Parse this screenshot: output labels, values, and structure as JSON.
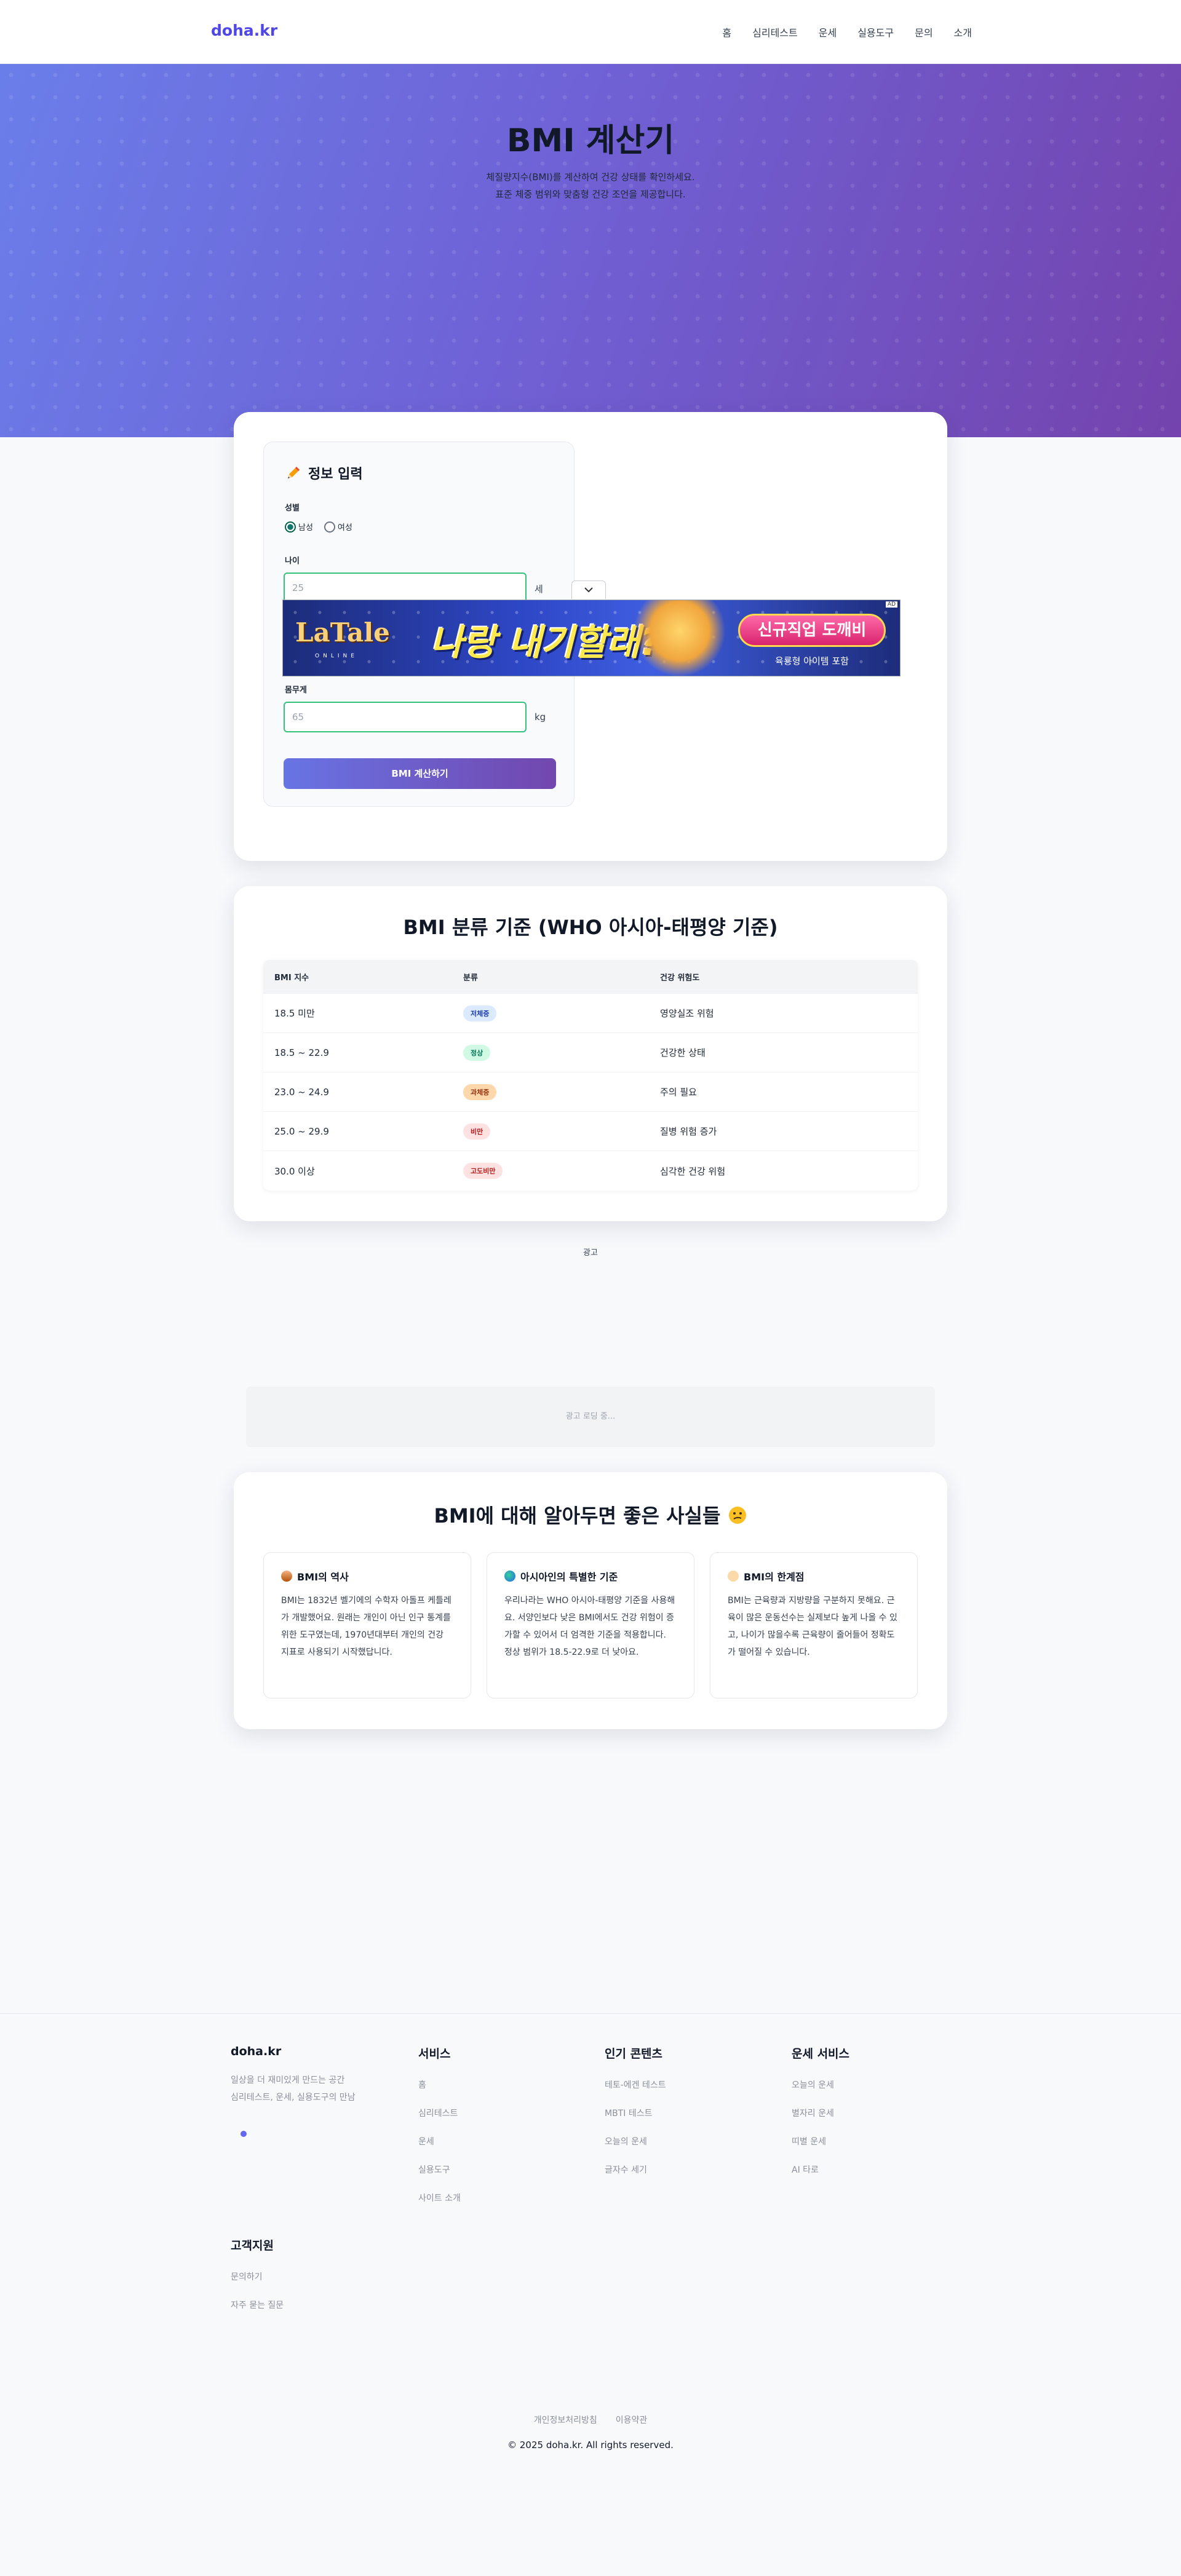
{
  "header": {
    "logo": "doha.kr",
    "nav": [
      "홈",
      "심리테스트",
      "운세",
      "실용도구",
      "문의",
      "소개"
    ]
  },
  "hero": {
    "title": "BMI 계산기",
    "subtitle_line1": "체질량지수(BMI)를 계산하여 건강 상태를 확인하세요.",
    "subtitle_line2": "표준 체중 범위와 맞춤형 건강 조언을 제공합니다."
  },
  "form": {
    "title": "정보 입력",
    "gender_label": "성별",
    "gender_options": [
      "남성",
      "여성"
    ],
    "gender_selected": "남성",
    "age_label": "나이",
    "age_placeholder": "25",
    "age_unit": "세",
    "weight_label": "몸무게",
    "weight_placeholder": "65",
    "weight_unit": "kg",
    "submit": "BMI 계산하기"
  },
  "ad_banner": {
    "logo": "LaTale",
    "logo_sub": "ONLINE",
    "headline": "나랑 내기할래?",
    "cta": "신규직업 도깨비",
    "sub": "육룡형 아이템 포함",
    "badge": "AD",
    "toggle_icon": "chevron-down-icon"
  },
  "table": {
    "title": "BMI 분류 기준 (WHO 아시아-태평양 기준)",
    "headers": [
      "BMI 지수",
      "분류",
      "건강 위험도"
    ],
    "rows": [
      {
        "range": "18.5 미만",
        "class": "저체중",
        "risk": "영양실조 위험",
        "bg": "#dbeafe",
        "fg": "#1e40af"
      },
      {
        "range": "18.5 ~ 22.9",
        "class": "정상",
        "risk": "건강한 상태",
        "bg": "#d1fae5",
        "fg": "#047857"
      },
      {
        "range": "23.0 ~ 24.9",
        "class": "과체중",
        "risk": "주의 필요",
        "bg": "#fed7aa",
        "fg": "#9a3412"
      },
      {
        "range": "25.0 ~ 29.9",
        "class": "비만",
        "risk": "질병 위험 증가",
        "bg": "#fee2e2",
        "fg": "#b91c1c"
      },
      {
        "range": "30.0 이상",
        "class": "고도비만",
        "risk": "심각한 건강 위험",
        "bg": "#fee2e2",
        "fg": "#b91c1c"
      }
    ]
  },
  "ad_section": {
    "label": "광고",
    "loading": "광고 로딩 중..."
  },
  "facts": {
    "title": "BMI에 대해 알아두면 좋은 사실들",
    "items": [
      {
        "icon": "ice-cream-icon",
        "title": "BMI의 역사",
        "body": "BMI는 1832년 벨기에의 수학자 아돌프 케틀레가 개발했어요. 원래는 개인이 아닌 인구 통계를 위한 도구였는데, 1970년대부터 개인의 건강 지표로 사용되기 시작했답니다."
      },
      {
        "icon": "globe-icon",
        "title": "아시아인의 특별한 기준",
        "body": "우리나라는 WHO 아시아-태평양 기준을 사용해요. 서양인보다 낮은 BMI에서도 건강 위험이 증가할 수 있어서 더 엄격한 기준을 적용합니다. 정상 범위가 18.5-22.9로 더 낮아요."
      },
      {
        "icon": "thinking-icon",
        "title": "BMI의 한계점",
        "body": "BMI는 근육량과 지방량을 구분하지 못해요. 근육이 많은 운동선수는 실제보다 높게 나올 수 있고, 나이가 많을수록 근육량이 줄어들어 정확도가 떨어질 수 있습니다."
      }
    ]
  },
  "footer": {
    "brand": "doha.kr",
    "desc_line1": "일상을 더 재미있게 만드는 공간",
    "desc_line2": "심리테스트, 운세, 실용도구의 만남",
    "columns": [
      {
        "title": "서비스",
        "links": [
          "홈",
          "심리테스트",
          "운세",
          "실용도구",
          "사이트 소개"
        ]
      },
      {
        "title": "인기 콘텐츠",
        "links": [
          "테토-에겐 테스트",
          "MBTI 테스트",
          "오늘의 운세",
          "글자수 세기"
        ]
      },
      {
        "title": "운세 서비스",
        "links": [
          "오늘의 운세",
          "별자리 운세",
          "띠별 운세",
          "AI 타로"
        ]
      }
    ],
    "support": {
      "title": "고객지원",
      "links": [
        "문의하기",
        "자주 묻는 질문"
      ]
    },
    "bottom_links": [
      "개인정보처리방침",
      "이용약관"
    ],
    "copyright": "© 2025 doha.kr. All rights reserved."
  },
  "colors": {
    "brand": "#4f46e5",
    "hero_start": "#6a7ee9",
    "hero_end": "#7443ad",
    "input_border": "#34c07f"
  }
}
